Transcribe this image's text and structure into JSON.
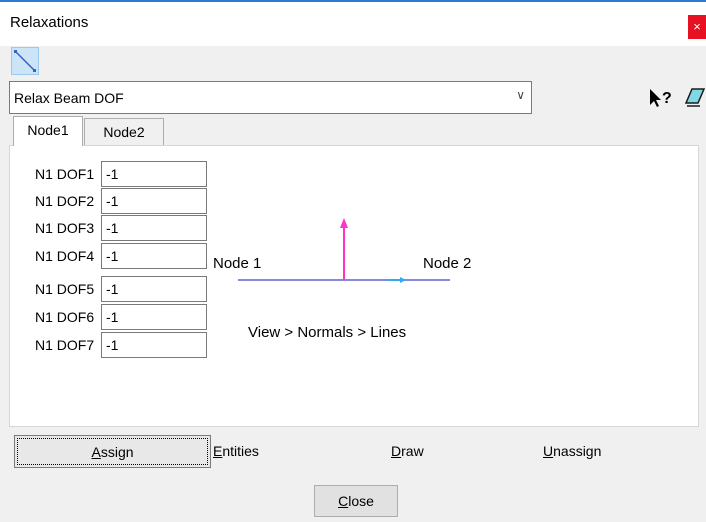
{
  "window": {
    "title": "Relaxations",
    "close_label": "×"
  },
  "dropdown": {
    "value": "Relax Beam DOF"
  },
  "tabs": [
    {
      "label": "Node1",
      "active": true
    },
    {
      "label": "Node2",
      "active": false
    }
  ],
  "dof_rows": [
    {
      "label": "N1 DOF1",
      "value": "-1"
    },
    {
      "label": "N1 DOF2",
      "value": "-1"
    },
    {
      "label": "N1 DOF3",
      "value": "-1"
    },
    {
      "label": "N1 DOF4",
      "value": "-1"
    },
    {
      "label": "N1 DOF5",
      "value": "-1"
    },
    {
      "label": "N1 DOF6",
      "value": "-1"
    },
    {
      "label": "N1 DOF7",
      "value": "-1"
    }
  ],
  "diagram": {
    "node1_label": "Node 1",
    "node2_label": "Node 2",
    "caption": "View > Normals > Lines",
    "colors": {
      "beam": "#8888dd",
      "normal": "#ff33cc",
      "direction": "#33aaee"
    }
  },
  "buttons": {
    "assign": {
      "pre": "",
      "ul": "A",
      "post": "ssign"
    },
    "entities": {
      "pre": "",
      "ul": "E",
      "post": "ntities"
    },
    "draw": {
      "pre": "",
      "ul": "D",
      "post": "raw"
    },
    "unassign": {
      "pre": "",
      "ul": "U",
      "post": "nassign"
    },
    "close": {
      "pre": "",
      "ul": "C",
      "post": "lose"
    }
  },
  "icons": {
    "line_tool": "line-tool-icon",
    "help": "context-help-icon",
    "eraser": "eraser-icon"
  }
}
